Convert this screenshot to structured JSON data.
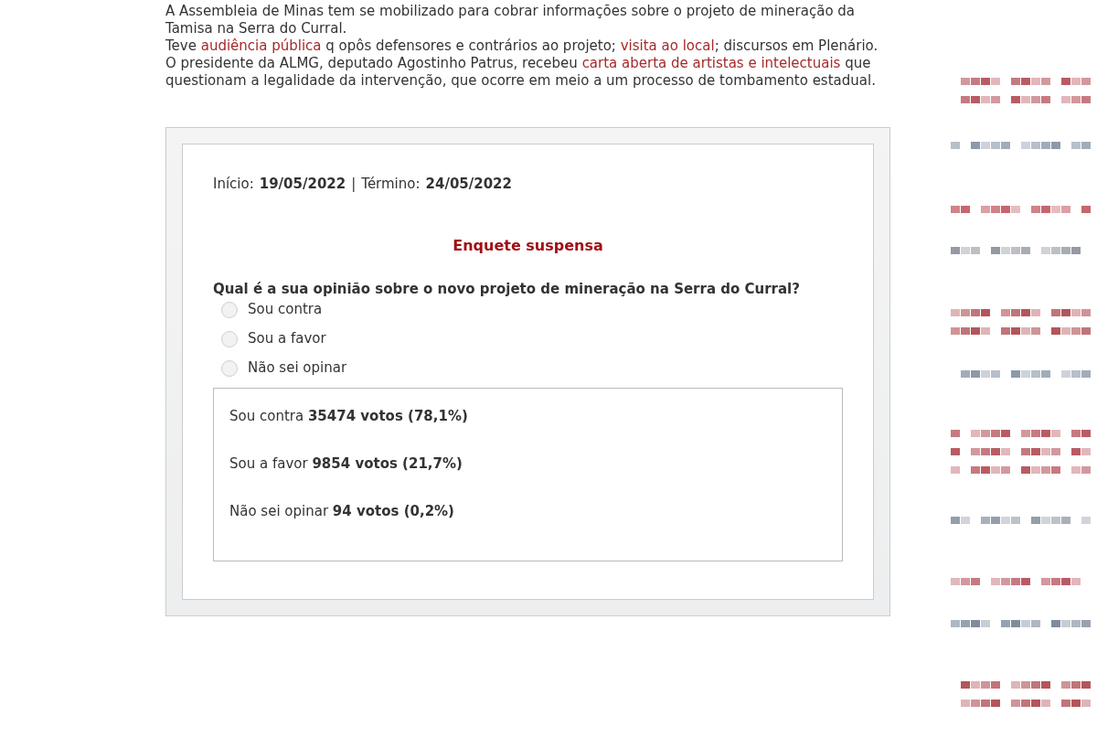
{
  "intro": [
    [
      {
        "kind": "text",
        "text": "A Assembleia de Minas tem se mobilizado para cobrar informações sobre o projeto de mineração da Tamisa na Serra do Curral."
      }
    ],
    [
      {
        "kind": "text",
        "text": "Teve "
      },
      {
        "kind": "link",
        "text": "audiência pública"
      },
      {
        "kind": "text",
        "text": " q opôs defensores e contrários ao projeto; "
      },
      {
        "kind": "link",
        "text": "visita ao local"
      },
      {
        "kind": "text",
        "text": "; discursos em Plenário. O presidente da ALMG, deputado Agostinho Patrus, recebeu "
      },
      {
        "kind": "link",
        "text": "carta aberta de artistas e intelectuais"
      },
      {
        "kind": "text",
        "text": " que questionam a legalidade da intervenção, que ocorre em meio a um processo de tombamento estadual."
      }
    ]
  ],
  "poll": {
    "dates": [
      {
        "label": "Início:",
        "value": "19/05/2022"
      },
      {
        "label": "Término:",
        "value": "24/05/2022"
      }
    ],
    "separator": "|",
    "status": "Enquete suspensa",
    "question": "Qual é a sua opinião sobre o novo projeto de mineração na Serra do Curral?",
    "options": [
      {
        "label": "Sou contra",
        "selected": false
      },
      {
        "label": "Sou a favor",
        "selected": false
      },
      {
        "label": "Não sei opinar",
        "selected": false
      }
    ],
    "results": [
      {
        "option": "Sou contra",
        "votes": "35474 votos (78,1%)"
      },
      {
        "option": "Sou a favor",
        "votes": "9854 votos (21,7%)"
      },
      {
        "option": "Não sei opinar",
        "votes": "94 votos (0,2%)"
      }
    ]
  }
}
